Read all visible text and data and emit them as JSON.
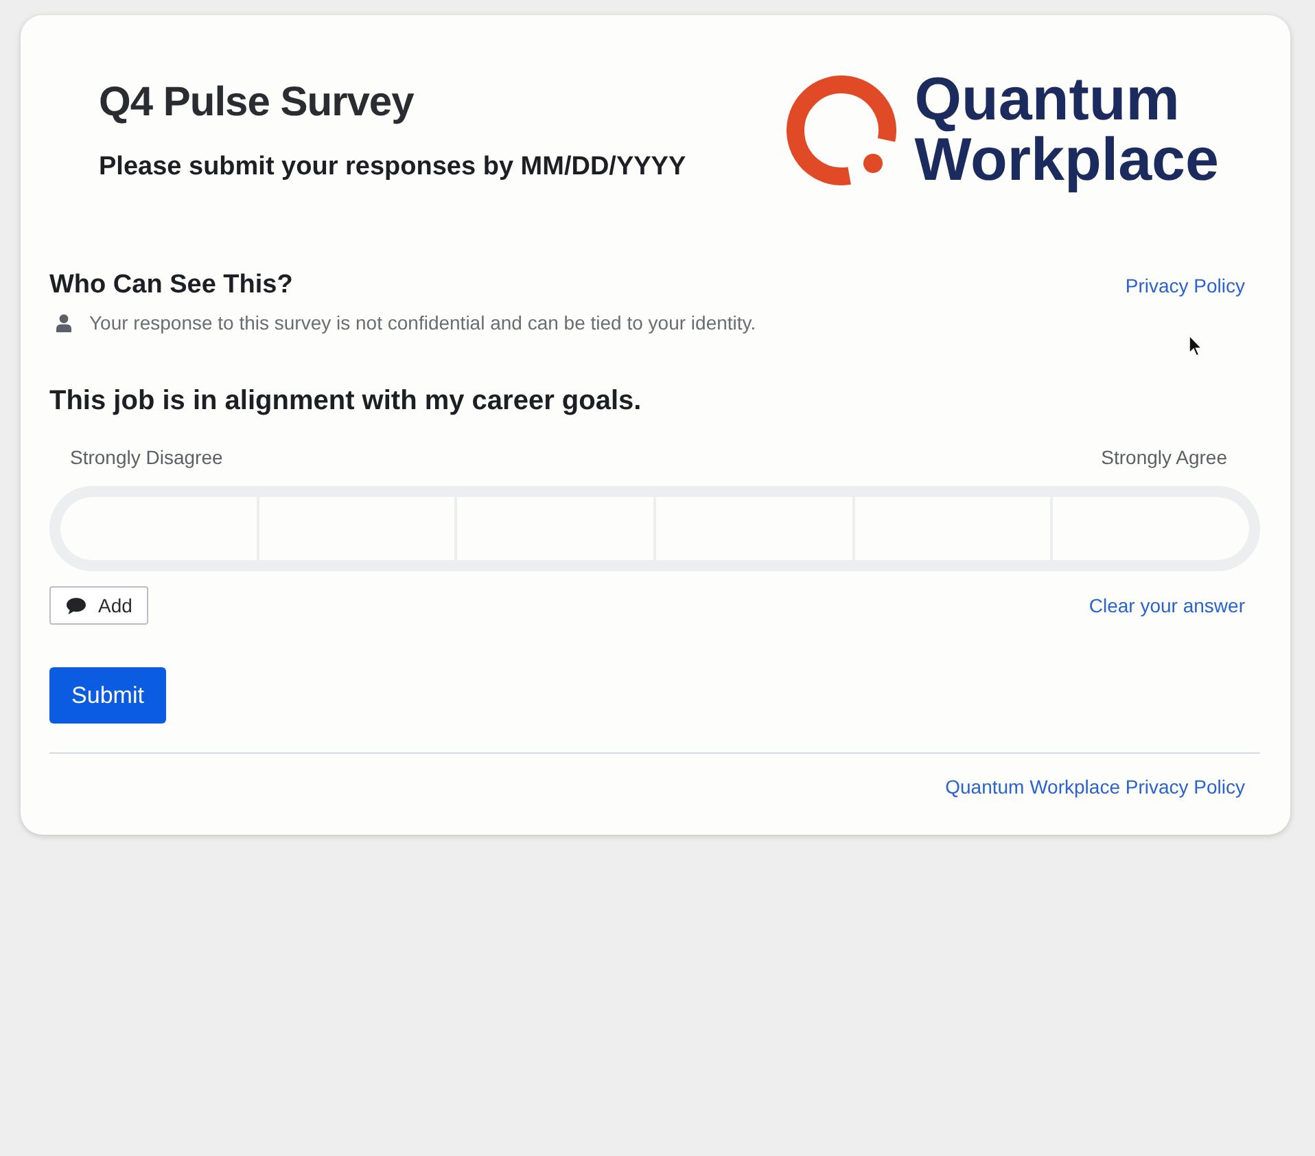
{
  "header": {
    "title": "Q4 Pulse Survey",
    "subtitle": "Please submit your responses by MM/DD/YYYY",
    "logo": {
      "lines": [
        "Quantum",
        "Workplace"
      ]
    }
  },
  "visibility": {
    "heading": "Who Can See This?",
    "link": "Privacy Policy",
    "note": "Your response to this survey is not confidential and can be tied to your identity."
  },
  "question": {
    "text": "This job is in alignment with my career goals.",
    "scale": {
      "min_label": "Strongly Disagree",
      "max_label": "Strongly Agree",
      "options": [
        {
          "selected": false
        },
        {
          "selected": false
        },
        {
          "selected": false
        },
        {
          "selected": false
        },
        {
          "selected": false
        },
        {
          "selected": false
        }
      ]
    },
    "comment_button": "Add",
    "clear_link": "Clear your answer"
  },
  "submit_button": "Submit",
  "footer": {
    "link": "Quantum Workplace Privacy Policy"
  }
}
